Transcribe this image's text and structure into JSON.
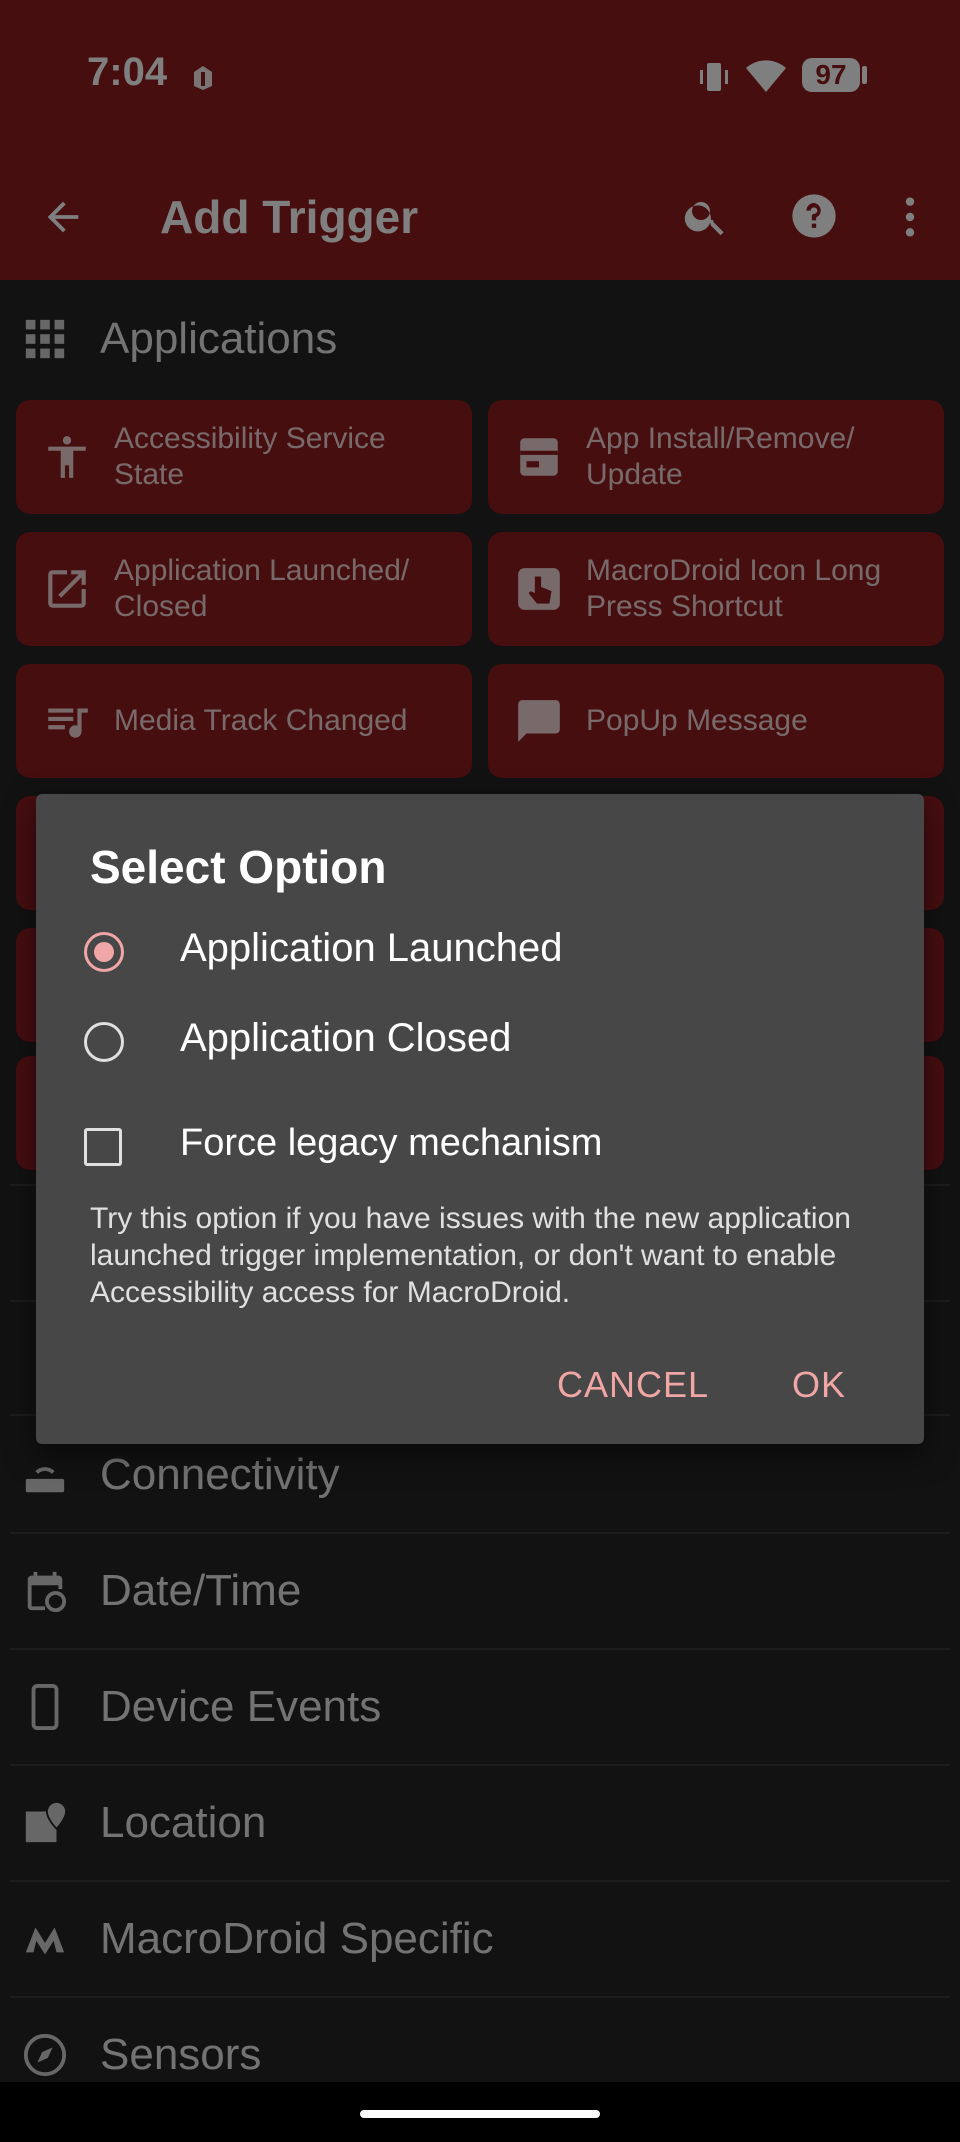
{
  "status_bar": {
    "time": "7:04",
    "battery": "97",
    "icons": [
      "notification-icon",
      "vibrate-icon",
      "wifi-icon",
      "battery-icon"
    ]
  },
  "app_bar": {
    "title": "Add Trigger",
    "icons": [
      "back-arrow-icon",
      "search-icon",
      "help-icon",
      "more-vert-icon"
    ]
  },
  "applications": {
    "label": "Applications",
    "tiles": [
      {
        "label": "Accessibility Service State",
        "icon": "accessibility-icon"
      },
      {
        "label": "App Install/Remove/ Update",
        "icon": "app-install-icon"
      },
      {
        "label": "Application Launched/ Closed",
        "icon": "open-in-new-icon"
      },
      {
        "label": "MacroDroid Icon Long Press Shortcut",
        "icon": "touch-icon"
      },
      {
        "label": "Media Track Changed",
        "icon": "music-queue-icon"
      },
      {
        "label": "PopUp Message",
        "icon": "message-icon"
      }
    ]
  },
  "categories": [
    {
      "label": "Connectivity",
      "icon": "router-icon"
    },
    {
      "label": "Date/Time",
      "icon": "calendar-clock-icon"
    },
    {
      "label": "Device Events",
      "icon": "phone-icon"
    },
    {
      "label": "Location",
      "icon": "map-pin-icon"
    },
    {
      "label": "MacroDroid Specific",
      "icon": "macrodroid-logo-icon"
    },
    {
      "label": "Sensors",
      "icon": "compass-icon"
    }
  ],
  "dialog": {
    "title": "Select Option",
    "options": [
      {
        "label": "Application Launched",
        "selected": true
      },
      {
        "label": "Application Closed",
        "selected": false
      }
    ],
    "checkbox": {
      "label": "Force legacy mechanism",
      "checked": false
    },
    "description": "Try this option if you have issues with the new application launched trigger implementation, or don't want to enable Accessibility access for MacroDroid.",
    "cancel": "CANCEL",
    "ok": "OK"
  },
  "colors": {
    "primary": "#8e1c21",
    "accent": "#f1a6a6",
    "dialog_bg": "#474747"
  }
}
